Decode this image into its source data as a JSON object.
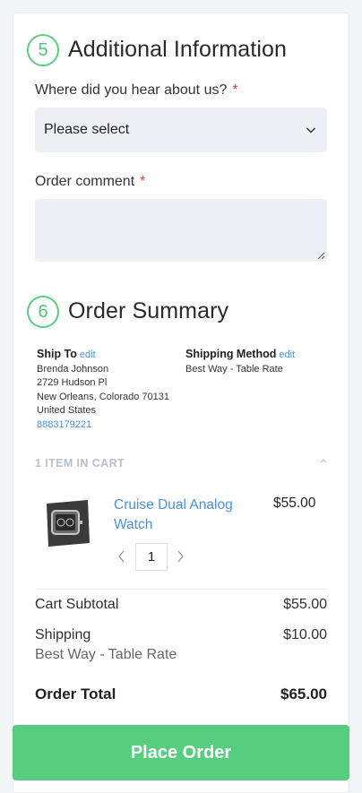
{
  "additional": {
    "step_number": "5",
    "title": "Additional Information",
    "hear_label": "Where did you hear about us?",
    "hear_required": "*",
    "hear_selected": "Please select",
    "comment_label": "Order comment",
    "comment_required": "*",
    "comment_value": ""
  },
  "summary": {
    "step_number": "6",
    "title": "Order Summary",
    "ship_to_label": "Ship To",
    "ship_to_edit": "edit",
    "ship_name": "Brenda Johnson",
    "ship_street": "2729 Hudson Pl",
    "ship_city": "New Orleans, Colorado 70131",
    "ship_country": "United States",
    "ship_phone": "8883179221",
    "method_label": "Shipping Method",
    "method_edit": "edit",
    "method_value": "Best Way - Table Rate",
    "items_header": "1 ITEM IN CART",
    "item": {
      "name": "Cruise Dual Analog Watch",
      "price": "$55.00",
      "qty": "1"
    },
    "subtotal_label": "Cart Subtotal",
    "subtotal_value": "$55.00",
    "shipping_label": "Shipping",
    "shipping_sub": "Best Way - Table Rate",
    "shipping_value": "$10.00",
    "total_label": "Order Total",
    "total_value": "$65.00"
  },
  "place_order_label": "Place Order",
  "colors": {
    "accent_green": "#57cd7e",
    "link_blue": "#4a90e2",
    "required_red": "#e0433e",
    "field_bg": "#edf0f4"
  },
  "icons": {
    "select_chevron": "chevron-down-icon",
    "collapse": "chevron-up-icon",
    "qty_decrease": "chevron-left-icon",
    "qty_increase": "chevron-right-icon"
  }
}
